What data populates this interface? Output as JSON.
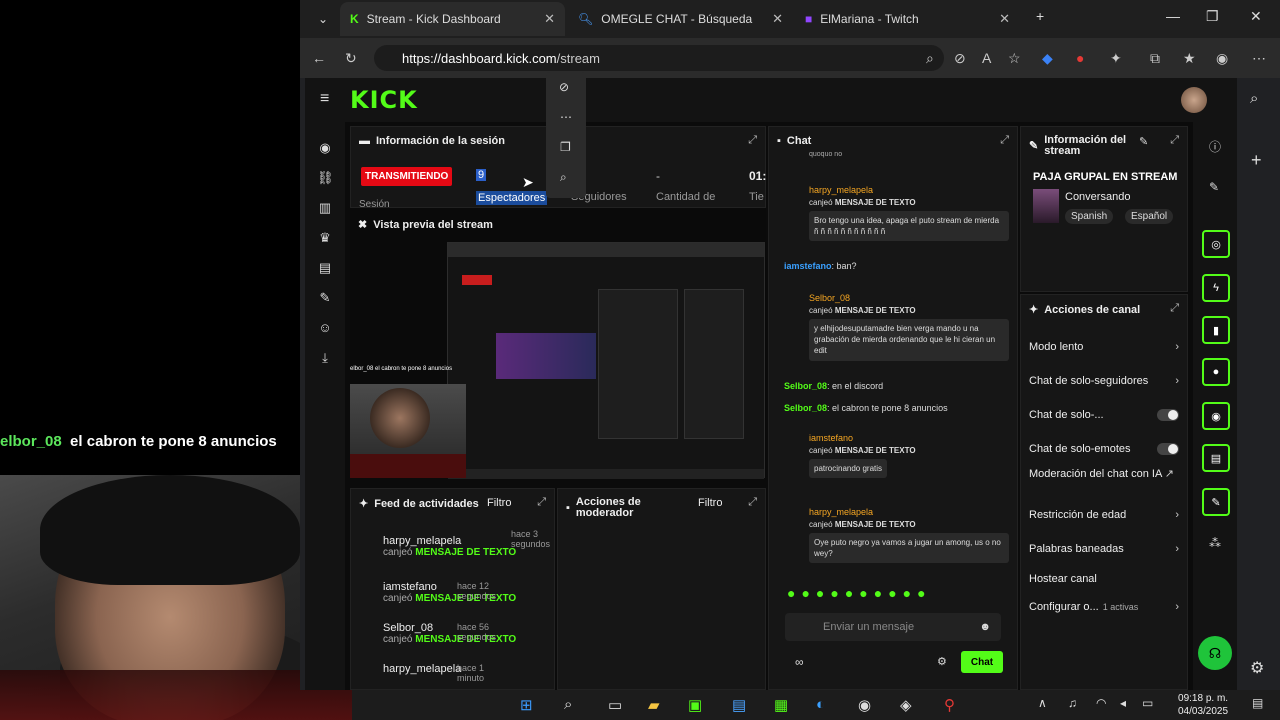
{
  "overlay": {
    "user": "elbor_08",
    "message": "el cabron te pone 8 anuncios"
  },
  "tabs": [
    {
      "label": "Stream - Kick Dashboard"
    },
    {
      "label": "OMEGLE CHAT - Búsqueda"
    },
    {
      "label": "ElMariana - Twitch"
    }
  ],
  "address": {
    "host": "https://dashboard.kick.com",
    "path": "/stream"
  },
  "logo": "KICK",
  "session": {
    "title": "Información de la sesión",
    "badge": "TRANSMITIENDO",
    "viewers_value": "9",
    "viewers_label": "Espectadores",
    "followers_label": "Seguidores",
    "amount_label": "Cantidad de",
    "amount_value": "-",
    "time_value": "01:",
    "time_label": "Tie",
    "session_label": "Sesión"
  },
  "preview": {
    "title": "Vista previa del stream",
    "inner_chat": "elbor_08 el cabron te pone 8 anuncios"
  },
  "feed": {
    "title": "Feed de actividades",
    "filter": "Filtro",
    "items": [
      {
        "user": "harpy_melapela",
        "time": "hace 3 segundos",
        "action": "canjeó",
        "item": "MENSAJE DE TEXTO"
      },
      {
        "user": "iamstefano",
        "time": "hace 12 segundos",
        "action": "canjeó",
        "item": "MENSAJE DE TEXTO"
      },
      {
        "user": "Selbor_08",
        "time": "hace 56 segundos",
        "action": "canjeó",
        "item": "MENSAJE DE TEXTO"
      },
      {
        "user": "harpy_melapela",
        "time": "hace 1 minuto"
      }
    ]
  },
  "mod": {
    "title": "Acciones de moderador",
    "filter": "Filtro"
  },
  "chat": {
    "title": "Chat",
    "top_text": "quoquo no",
    "messages": [
      {
        "user": "harpy_melapela",
        "action": "canjeó",
        "item": "MENSAJE DE TEXTO",
        "text": "Bro tengo una idea, apaga el puto stream de mierda ñ ñ ñ ñ ñ ñ ñ ñ ñ ñ ñ"
      },
      {
        "plain_user": "iamstefano",
        "plain_text": "ban?"
      },
      {
        "user": "Selbor_08",
        "action": "canjeó",
        "item": "MENSAJE DE TEXTO",
        "text": "y elhijodesuputamadre bien verga mando u na grabación de mierda ordenando que le hi cieran un edit"
      },
      {
        "plain_user": "Selbor_08",
        "plain_text": "en el discord"
      },
      {
        "plain_user": "Selbor_08",
        "plain_text": "el cabron te pone 8 anuncios"
      },
      {
        "user": "iamstefano",
        "action": "canjeó",
        "item": "MENSAJE DE TEXTO",
        "text": "patrocinando gratis"
      },
      {
        "user": "harpy_melapela",
        "action": "canjeó",
        "item": "MENSAJE DE TEXTO",
        "text": "Oye puto negro ya vamos a jugar un among, us o no wey?"
      }
    ],
    "placeholder": "Enviar un mensaje",
    "send": "Chat"
  },
  "stream_info": {
    "title": "Información del stream",
    "stream_title": "PAJA GRUPAL EN STREAM",
    "category": "Conversando",
    "tags": [
      "Spanish",
      "Español"
    ]
  },
  "actions": {
    "title": "Acciones de canal",
    "items": [
      {
        "label": "Modo lento"
      },
      {
        "label": "Chat de solo-seguidores"
      },
      {
        "label": "Chat de solo-..."
      },
      {
        "label": "Chat de solo-emotes"
      },
      {
        "label": "Moderación del chat con IA"
      },
      {
        "label": "Restricción de edad"
      },
      {
        "label": "Palabras baneadas"
      },
      {
        "label": "Hostear canal"
      },
      {
        "label": "Configurar o...",
        "extra": "1 activas"
      }
    ]
  },
  "taskbar": {
    "time": "09:18 p. m.",
    "date": "04/03/2025"
  }
}
